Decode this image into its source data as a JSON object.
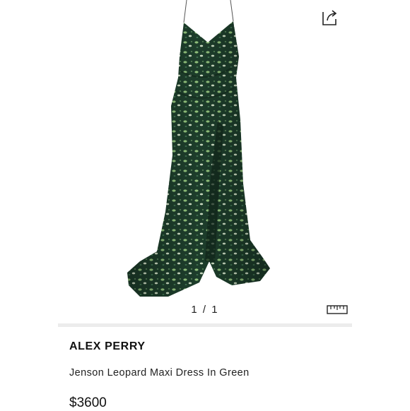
{
  "gallery": {
    "image_alt": "green leopard maxi dress",
    "pager": "1 / 1",
    "share_icon": "share-icon",
    "ruler_icon": "size-guide-ruler-icon"
  },
  "product": {
    "brand": "ALEX PERRY",
    "name": "Jenson Leopard Maxi Dress In Green",
    "price": "$3600"
  },
  "colors": {
    "dress_dark": "#1c3a2a",
    "dress_mid": "#2f5e41",
    "dress_light": "#9fc58a",
    "divider": "#ececec"
  }
}
